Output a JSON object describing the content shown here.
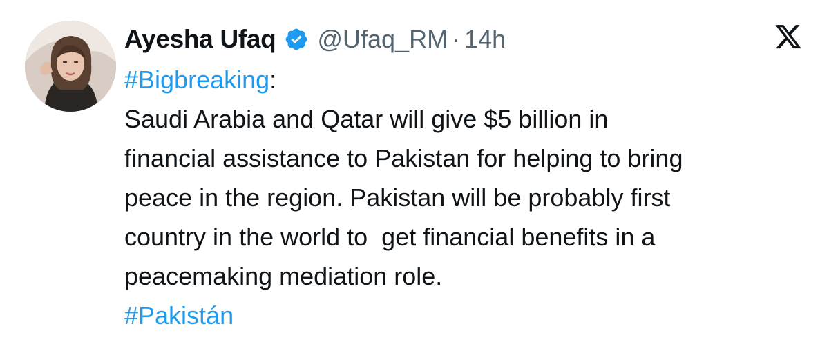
{
  "author": {
    "display_name": "Ayesha Ufaq",
    "verified_icon": "verified-badge-icon",
    "handle": "@Ufaq_RM",
    "separator": "·",
    "timestamp": "14h"
  },
  "platform_logo": "x-logo-icon",
  "tweet": {
    "hashtag_top": "#Bigbreaking",
    "hashtag_top_suffix": ":",
    "lines": [
      "Saudi Arabia and Qatar will give $5 billion in",
      "financial assistance to Pakistan for helping to bring",
      "peace in the region. Pakistan will be probably first",
      "country in the world to  get financial benefits in a",
      "peacemaking mediation role."
    ],
    "hashtag_bottom": "#Pakistán"
  },
  "colors": {
    "link": "#1d9bf0",
    "text": "#0f1419",
    "secondary": "#536471",
    "verified": "#1d9bf0"
  }
}
